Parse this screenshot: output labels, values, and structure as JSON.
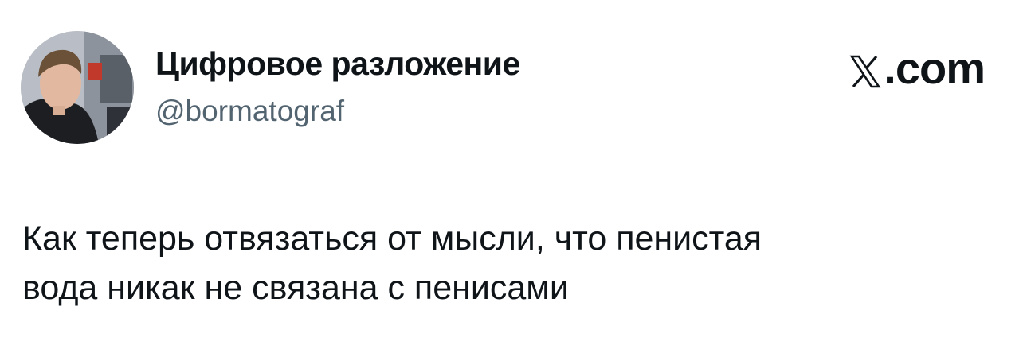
{
  "author": {
    "display_name": "Цифровое разложение",
    "handle": "@bormatograf",
    "avatar_icon": "profile-photo"
  },
  "brand": {
    "logo_icon": "x-logo-icon",
    "suffix": ".com"
  },
  "tweet": {
    "lines": [
      "Как теперь отвязаться от мысли, что пенистая",
      "вода никак не связана с пенисами"
    ]
  },
  "colors": {
    "text_primary": "#0f1419",
    "text_secondary": "#536471",
    "background": "#ffffff"
  }
}
